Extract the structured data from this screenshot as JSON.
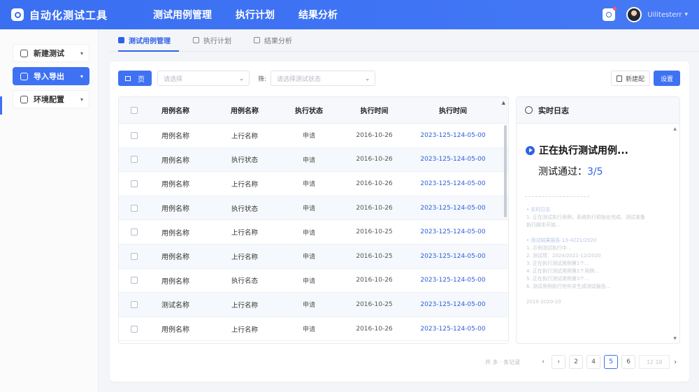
{
  "app": {
    "title": "自动化测试工具"
  },
  "topnav": [
    "测试用例管理",
    "执行计划",
    "结果分析"
  ],
  "user": {
    "name": "Uilitesterr"
  },
  "sidebar": {
    "items": [
      {
        "label": "新建测试",
        "icon": "new-test-icon"
      },
      {
        "label": "导入导出",
        "icon": "import-export-icon"
      },
      {
        "label": "环境配置",
        "icon": "environment-icon"
      }
    ]
  },
  "subtabs": [
    "测试用例管理",
    "执行计划",
    "结果分析"
  ],
  "filters": {
    "page_button": "页",
    "select1_placeholder": "请选择",
    "label": "筛:",
    "select2_placeholder": "请选择测试状态"
  },
  "actions": {
    "new": "新建配",
    "settings": "设置"
  },
  "table": {
    "headers": [
      "用例名称",
      "用例名称",
      "执行状态",
      "执行时间",
      "执行时间"
    ],
    "rows": [
      [
        "用例名称",
        "上行名称",
        "申请",
        "2016-10-26",
        "2023-125-124-05-00"
      ],
      [
        "用例名称",
        "执行状态",
        "申请",
        "2016-10-26",
        "2023-125-124-05-00"
      ],
      [
        "用例名称",
        "上行名称",
        "申请",
        "2016-10-26",
        "2023-125-124-05-00"
      ],
      [
        "用例名称",
        "执行状态",
        "申请",
        "2016-10-26",
        "2023-125-124-05-00"
      ],
      [
        "用例名称",
        "上行名称",
        "申请",
        "2016-10-25",
        "2023-125-124-05-00"
      ],
      [
        "用例名称",
        "上行名称",
        "申请",
        "2016-10-25",
        "2023-125-124-05-00"
      ],
      [
        "用例名称",
        "执行名态",
        "申请",
        "2016-10-26",
        "2023-125-124-05-00"
      ],
      [
        "测试名称",
        "上行名称",
        "申请",
        "2016-10-25",
        "2023-125-124-05-00"
      ],
      [
        "用例名称",
        "上行名称",
        "申请",
        "2016-10-26",
        "2023-125-124-05-00"
      ]
    ]
  },
  "log": {
    "title": "实时日志",
    "running": "正在执行测试用例...",
    "pass_label": "测试通过：",
    "pass_value": "3/5",
    "lines": [
      "• 实时日志",
      "1. 正在测试执行用例，系统执行初始化完成，测试准备",
      "   执行脚本开始...",
      "",
      "• 测试结果报告-13-4221/2020",
      "1. 示例测试执行中...",
      "2. 测试项：2024/2021-12/2020",
      "3. 正在执行测试用例第1个...",
      "4. 正在执行测试用例第2个用例...",
      "5. 正在执行测试用例第3个...",
      "6. 测试用例执行完毕并生成测试报告...",
      "",
      "  2010-2020-10"
    ]
  },
  "pager": {
    "info": "共 多 · 条记录",
    "pages": [
      "2",
      "4",
      "5",
      "6"
    ],
    "active": "5",
    "jump": "12  18"
  },
  "colors": {
    "primary": "#3e72f3",
    "link": "#2d5ed8"
  }
}
